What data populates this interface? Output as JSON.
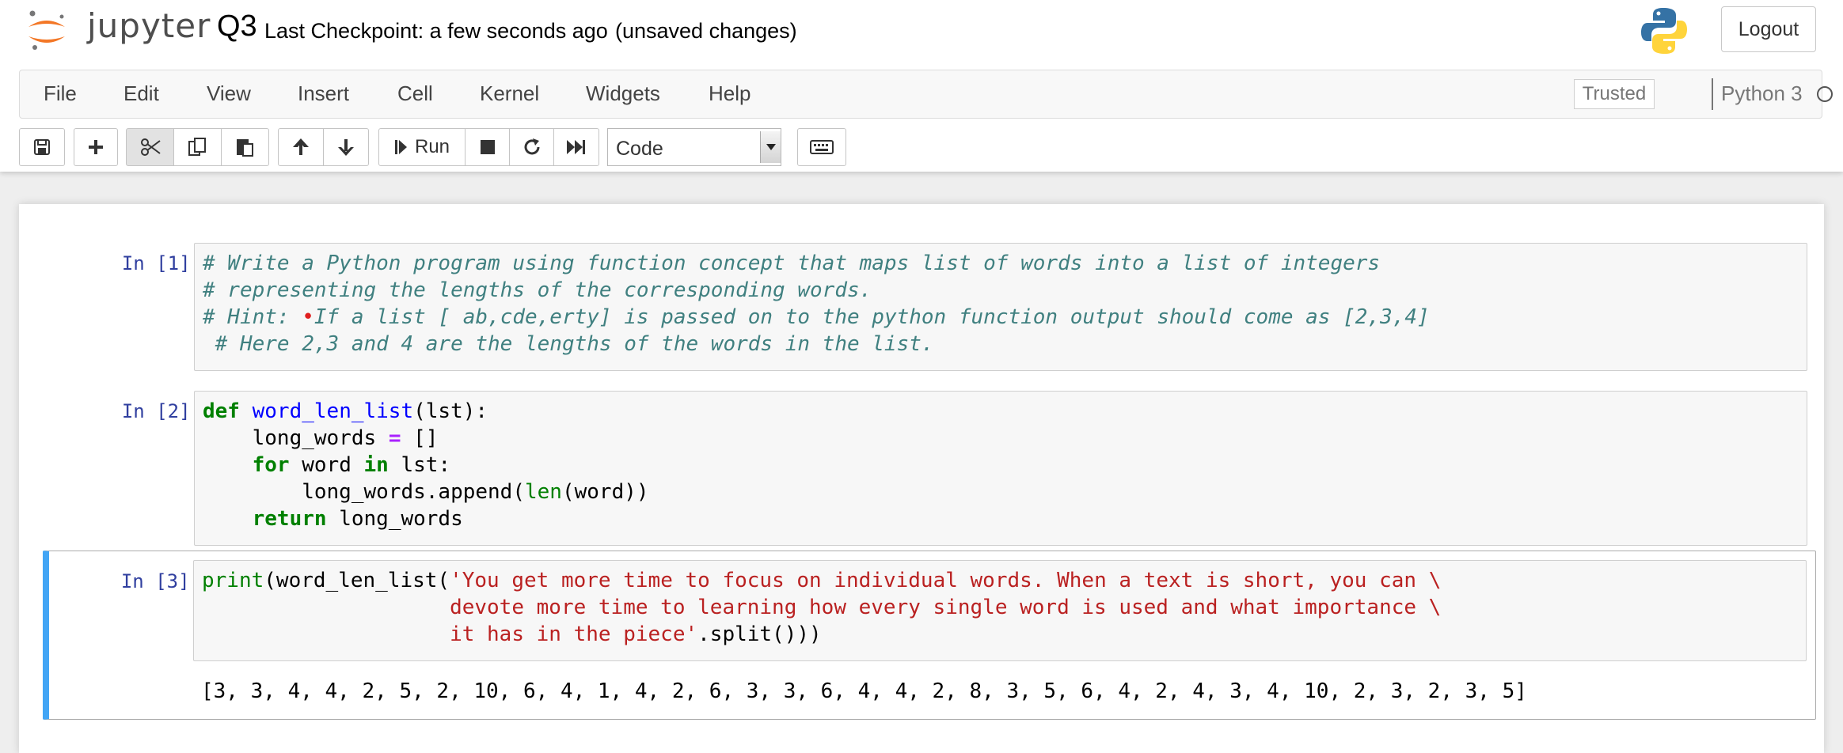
{
  "header": {
    "logo_text": "jupyter",
    "notebook_name": "Q3",
    "checkpoint": "Last Checkpoint: a few seconds ago",
    "unsaved": "(unsaved changes)",
    "logout_label": "Logout"
  },
  "menubar": {
    "items": [
      "File",
      "Edit",
      "View",
      "Insert",
      "Cell",
      "Kernel",
      "Widgets",
      "Help"
    ],
    "trusted_label": "Trusted",
    "kernel_name": "Python 3"
  },
  "toolbar": {
    "run_label": "Run",
    "cell_type": "Code",
    "buttons": [
      "save-icon",
      "plus-icon",
      "scissors-icon",
      "copy-icon",
      "paste-icon",
      "arrow-up-icon",
      "arrow-down-icon",
      "run-icon",
      "stop-icon",
      "restart-icon",
      "fast-forward-icon",
      "keyboard-icon"
    ]
  },
  "cells": {
    "c1": {
      "prompt": "In [1]:",
      "lines": [
        "# Write a Python program using function concept that maps list of words into a list of integers",
        "# representing the lengths of the corresponding words.",
        "# Hint: ",
        "•",
        "If a list [ ab,cde,erty] is passed on to the python function output should come as [2,3,4]",
        " # Here 2,3 and 4 are the lengths of the words in the list."
      ]
    },
    "c2": {
      "prompt": "In [2]:",
      "l1": [
        "def",
        " ",
        "word_len_list",
        "(lst):"
      ],
      "l2": [
        "    long_words ",
        "=",
        " []"
      ],
      "l3": [
        "    ",
        "for",
        " word ",
        "in",
        " lst:"
      ],
      "l4": [
        "        long_words.append(",
        "len",
        "(word))"
      ],
      "l5": [
        "    ",
        "return",
        " long_words"
      ]
    },
    "c3": {
      "prompt": "In [3]:",
      "l1": [
        "print",
        "(word_len_list(",
        "'You get more time to focus on individual words. When a text is short, you can \\"
      ],
      "l2": "                    devote more time to learning how every single word is used and what importance \\",
      "l3": [
        "                    it has in the piece'",
        ".split()))"
      ],
      "output": "[3, 3, 4, 4, 2, 5, 2, 10, 6, 4, 1, 4, 2, 6, 3, 3, 6, 4, 4, 2, 8, 3, 5, 6, 4, 2, 4, 3, 4, 10, 2, 3, 2, 3, 5]"
    }
  },
  "colors": {
    "selected_cell_bar": "#42a5f5",
    "prompt_color": "#303f9f",
    "comment_color": "#408080",
    "keyword_color": "#008000",
    "string_color": "#ba2121",
    "jupyter_orange": "#f37726"
  }
}
